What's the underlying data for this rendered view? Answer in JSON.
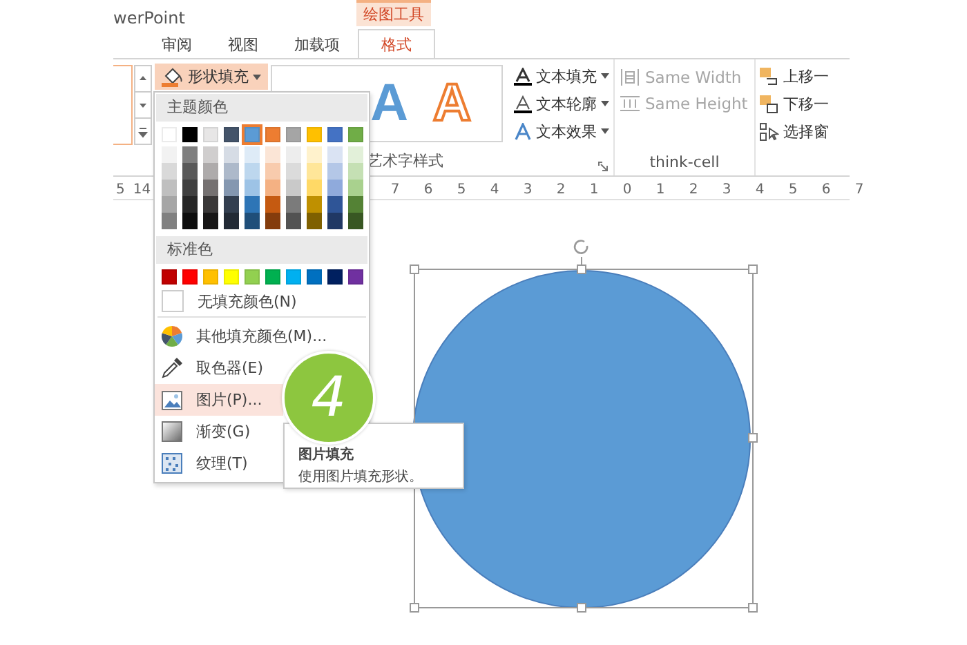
{
  "window": {
    "title": "werPoint"
  },
  "context_tab": {
    "label": "绘图工具"
  },
  "tabs": [
    {
      "label": "审阅",
      "selected": false
    },
    {
      "label": "视图",
      "selected": false
    },
    {
      "label": "加载项",
      "selected": false
    },
    {
      "label": "格式",
      "selected": true
    }
  ],
  "ribbon": {
    "shape_fill_button": {
      "label": "形状填充",
      "expanded": true
    },
    "wordart_styles": {
      "samples": [
        {
          "label": "A",
          "kind": "filled"
        },
        {
          "label": "A",
          "kind": "outline"
        }
      ],
      "group_label": "艺术字样式"
    },
    "text_buttons": [
      {
        "label": "文本填充",
        "kind": "fill"
      },
      {
        "label": "文本轮廓",
        "kind": "outline"
      },
      {
        "label": "文本效果",
        "kind": "effects"
      }
    ],
    "think_cell": {
      "items": [
        {
          "label": "Same Width",
          "kind": "width",
          "disabled": true
        },
        {
          "label": "Same Height",
          "kind": "height",
          "disabled": true
        }
      ],
      "group_label": "think-cell"
    },
    "arrange": [
      {
        "label": "上移一",
        "kind": "forward"
      },
      {
        "label": "下移一",
        "kind": "backward"
      },
      {
        "label": "选择窗",
        "kind": "pane"
      }
    ]
  },
  "ruler": {
    "left_labels": [
      "5",
      "14"
    ],
    "right_labels": [
      "7",
      "6",
      "5",
      "4",
      "3",
      "2",
      "1",
      "0",
      "1",
      "2",
      "3",
      "4",
      "5",
      "6",
      "7"
    ]
  },
  "fill_menu": {
    "theme_header": "主题颜色",
    "theme_colors": [
      {
        "color": "#ffffff",
        "selected": false,
        "shades": [
          {
            "color": "#f2f2f2"
          },
          {
            "color": "#d9d9d9"
          },
          {
            "color": "#bfbfbf"
          },
          {
            "color": "#a6a6a6"
          },
          {
            "color": "#808080"
          }
        ]
      },
      {
        "color": "#000000",
        "selected": false,
        "shades": [
          {
            "color": "#7f7f7f"
          },
          {
            "color": "#595959"
          },
          {
            "color": "#404040"
          },
          {
            "color": "#262626"
          },
          {
            "color": "#0d0d0d"
          }
        ]
      },
      {
        "color": "#e7e6e6",
        "selected": false,
        "shades": [
          {
            "color": "#d0cece"
          },
          {
            "color": "#aeabab"
          },
          {
            "color": "#757171"
          },
          {
            "color": "#3a3838"
          },
          {
            "color": "#171616"
          }
        ]
      },
      {
        "color": "#44546a",
        "selected": false,
        "shades": [
          {
            "color": "#d6dce5"
          },
          {
            "color": "#adb9ca"
          },
          {
            "color": "#8497b0"
          },
          {
            "color": "#333f50"
          },
          {
            "color": "#222a35"
          }
        ]
      },
      {
        "color": "#5b9bd5",
        "selected": true,
        "shades": [
          {
            "color": "#deebf7"
          },
          {
            "color": "#bdd7ee"
          },
          {
            "color": "#9dc3e6"
          },
          {
            "color": "#2e75b6"
          },
          {
            "color": "#1f4e79"
          }
        ]
      },
      {
        "color": "#ed7d31",
        "selected": false,
        "shades": [
          {
            "color": "#fbe5d6"
          },
          {
            "color": "#f8cbad"
          },
          {
            "color": "#f4b183"
          },
          {
            "color": "#c55a11"
          },
          {
            "color": "#843c0c"
          }
        ]
      },
      {
        "color": "#a5a5a5",
        "selected": false,
        "shades": [
          {
            "color": "#ededed"
          },
          {
            "color": "#dbdbdb"
          },
          {
            "color": "#c9c9c9"
          },
          {
            "color": "#7b7b7b"
          },
          {
            "color": "#525252"
          }
        ]
      },
      {
        "color": "#ffc000",
        "selected": false,
        "shades": [
          {
            "color": "#fff2cc"
          },
          {
            "color": "#ffe699"
          },
          {
            "color": "#ffd966"
          },
          {
            "color": "#bf9000"
          },
          {
            "color": "#7f6000"
          }
        ]
      },
      {
        "color": "#4472c4",
        "selected": false,
        "shades": [
          {
            "color": "#dae3f3"
          },
          {
            "color": "#b4c7e7"
          },
          {
            "color": "#8faadc"
          },
          {
            "color": "#2f5597"
          },
          {
            "color": "#203864"
          }
        ]
      },
      {
        "color": "#70ad47",
        "selected": false,
        "shades": [
          {
            "color": "#e2f0d9"
          },
          {
            "color": "#c5e0b4"
          },
          {
            "color": "#a9d18e"
          },
          {
            "color": "#548235"
          },
          {
            "color": "#385723"
          }
        ]
      }
    ],
    "standard_header": "标准色",
    "standard_colors": [
      {
        "color": "#c00000"
      },
      {
        "color": "#ff0000"
      },
      {
        "color": "#ffc000"
      },
      {
        "color": "#ffff00"
      },
      {
        "color": "#92d050"
      },
      {
        "color": "#00b050"
      },
      {
        "color": "#00b0f0"
      },
      {
        "color": "#0070c0"
      },
      {
        "color": "#002060"
      },
      {
        "color": "#7030a0"
      }
    ],
    "items": [
      {
        "label": "无填充颜色(N)",
        "kind": "no-fill",
        "selected": false
      },
      {
        "label": "其他填充颜色(M)...",
        "kind": "more-colors",
        "selected": false
      },
      {
        "label": "取色器(E)",
        "kind": "eyedropper",
        "selected": false
      },
      {
        "label": "图片(P)...",
        "kind": "picture",
        "selected": true
      },
      {
        "label": "渐变(G)",
        "kind": "gradient",
        "selected": false
      },
      {
        "label": "纹理(T)",
        "kind": "texture",
        "selected": false
      }
    ]
  },
  "step_badge": {
    "label": "4"
  },
  "tooltip": {
    "title": "图片填充",
    "description": "使用图片填充形状。"
  }
}
